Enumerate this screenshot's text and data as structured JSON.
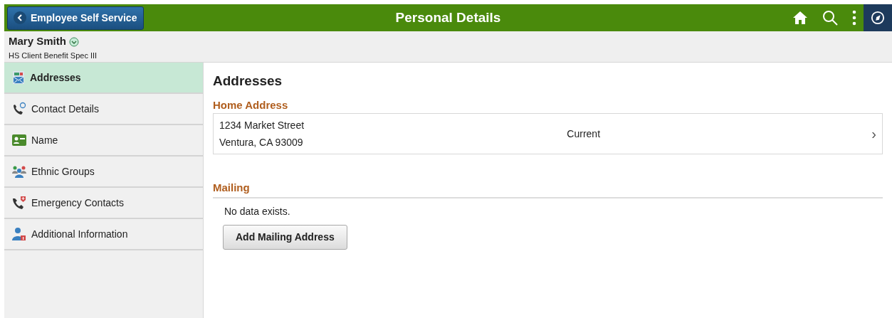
{
  "header": {
    "back_button": "Employee Self Service",
    "title": "Personal Details"
  },
  "person": {
    "name": "Mary Smith",
    "job_title": "HS Client Benefit Spec III"
  },
  "sidebar": {
    "items": [
      {
        "label": "Addresses",
        "kind": "address",
        "selected": true
      },
      {
        "label": "Contact Details",
        "kind": "contact",
        "selected": false
      },
      {
        "label": "Name",
        "kind": "name",
        "selected": false
      },
      {
        "label": "Ethnic Groups",
        "kind": "groups",
        "selected": false
      },
      {
        "label": "Emergency Contacts",
        "kind": "emergency",
        "selected": false
      },
      {
        "label": "Additional Information",
        "kind": "info",
        "selected": false
      }
    ]
  },
  "content": {
    "heading": "Addresses",
    "home_address": {
      "heading": "Home Address",
      "line_1": "1234 Market Street",
      "line_2": "Ventura, CA 93009",
      "status": "Current",
      "chevron": "›"
    },
    "mailing": {
      "heading": "Mailing",
      "message": "No data exists.",
      "button": "Add Mailing Address"
    }
  }
}
